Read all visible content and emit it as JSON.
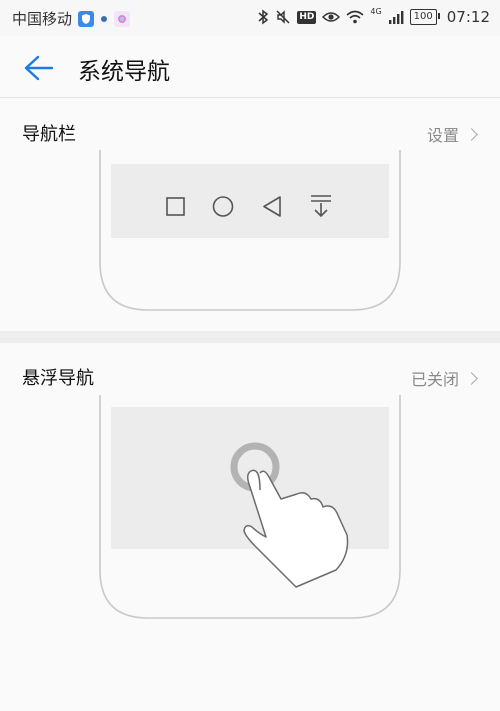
{
  "status_bar": {
    "carrier": "中国移动",
    "network_tag": "4G",
    "hd_label": "HD",
    "battery": "100",
    "time": "07:12"
  },
  "header": {
    "title": "系统导航",
    "back_icon": "arrow-left-icon"
  },
  "nav_bar_section": {
    "label": "导航栏",
    "value": "设置",
    "buttons": [
      "square-icon",
      "circle-icon",
      "triangle-back-icon",
      "hide-nav-icon"
    ]
  },
  "floating_nav_section": {
    "label": "悬浮导航",
    "value": "已关闭"
  },
  "colors": {
    "accent": "#1a7be6",
    "background": "#fafafa",
    "divider": "#e3e3e3"
  }
}
